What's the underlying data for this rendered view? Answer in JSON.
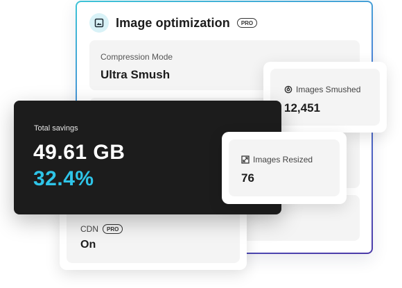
{
  "panel": {
    "title": "Image optimization",
    "pro_badge": "PRO",
    "header_icon": "image-icon"
  },
  "compression": {
    "label": "Compression Mode",
    "value": "Ultra Smush"
  },
  "smushed": {
    "icon": "smush-icon",
    "label": "Images Smushed",
    "value": "12,451"
  },
  "resized": {
    "icon": "resize-icon",
    "label": "Images Resized",
    "value": "76"
  },
  "savings": {
    "label": "Total savings",
    "amount": "49.61 GB",
    "percent": "32.4%"
  },
  "cdn": {
    "label": "CDN",
    "pro_badge": "PRO",
    "value": "On"
  },
  "colors": {
    "accent": "#2ec4e8",
    "dark_card": "#1c1c1c",
    "border_gradient_start": "#3cc3d6",
    "border_gradient_end": "#4b3aa8"
  }
}
